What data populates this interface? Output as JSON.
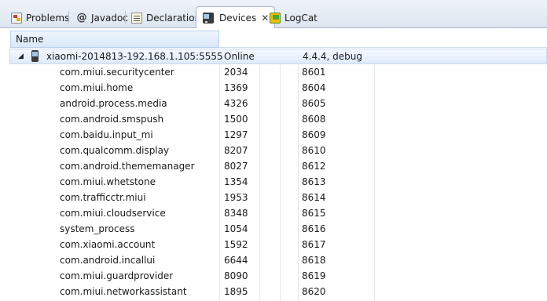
{
  "tabs": [
    {
      "label": "Problems",
      "icon": "problems-icon"
    },
    {
      "label": "Javadoc",
      "icon": "at-sign-icon"
    },
    {
      "label": "Declaration",
      "icon": "declaration-icon"
    },
    {
      "label": "Devices",
      "icon": "phone-icon",
      "active": true
    },
    {
      "label": "LogCat",
      "icon": "logcat-icon"
    }
  ],
  "table": {
    "name_header": "Name"
  },
  "device": {
    "name": "xiaomi-2014813-192.168.1.105:5555",
    "status": "Online",
    "version": "4.4.4, debug"
  },
  "processes": [
    {
      "name": "com.miui.securitycenter",
      "pid": "2034",
      "port": "8601"
    },
    {
      "name": "com.miui.home",
      "pid": "1369",
      "port": "8604"
    },
    {
      "name": "android.process.media",
      "pid": "4326",
      "port": "8605"
    },
    {
      "name": "com.android.smspush",
      "pid": "1500",
      "port": "8608"
    },
    {
      "name": "com.baidu.input_mi",
      "pid": "1297",
      "port": "8609"
    },
    {
      "name": "com.qualcomm.display",
      "pid": "8207",
      "port": "8610"
    },
    {
      "name": "com.android.thememanager",
      "pid": "8027",
      "port": "8612"
    },
    {
      "name": "com.miui.whetstone",
      "pid": "1354",
      "port": "8613"
    },
    {
      "name": "com.trafficctr.miui",
      "pid": "1953",
      "port": "8614"
    },
    {
      "name": "com.miui.cloudservice",
      "pid": "8348",
      "port": "8615"
    },
    {
      "name": "system_process",
      "pid": "1054",
      "port": "8616"
    },
    {
      "name": "com.xiaomi.account",
      "pid": "1592",
      "port": "8617"
    },
    {
      "name": "com.android.incallui",
      "pid": "6644",
      "port": "8618"
    },
    {
      "name": "com.miui.guardprovider",
      "pid": "8090",
      "port": "8619"
    },
    {
      "name": "com.miui.networkassistant",
      "pid": "1895",
      "port": "8620"
    }
  ],
  "colors": {
    "accent": "#d8e8fa",
    "tabbar": "#dde6f0"
  }
}
